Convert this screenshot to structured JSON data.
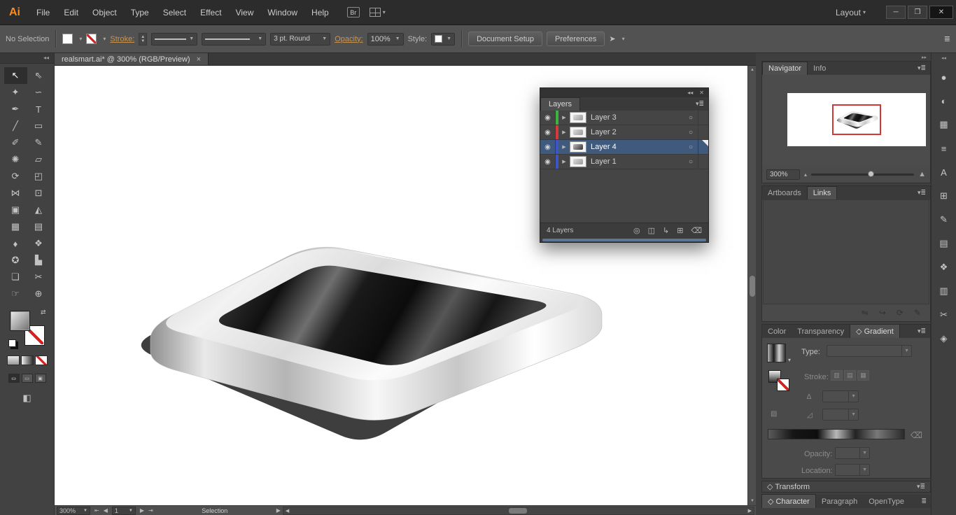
{
  "window_controls": {
    "minimize": "─",
    "restore": "❐",
    "close": "✕"
  },
  "menubar": {
    "logo": "Ai",
    "items": [
      "File",
      "Edit",
      "Object",
      "Type",
      "Select",
      "Effect",
      "View",
      "Window",
      "Help"
    ],
    "bridge_badge": "Br",
    "layout_label": "Layout",
    "caret": "▾"
  },
  "controlbar": {
    "selection_status": "No Selection",
    "stroke_label": "Stroke:",
    "brush_size_value": "3 pt. Round",
    "opacity_label": "Opacity:",
    "opacity_value": "100%",
    "style_label": "Style:",
    "document_setup": "Document Setup",
    "preferences": "Preferences",
    "select_similar_icon": "➤",
    "panel_menu_icon": "≣"
  },
  "document_tab": {
    "title": "realsmart.ai* @ 300% (RGB/Preview)",
    "close": "×"
  },
  "toolbar": {
    "collapse": "◂◂",
    "tools": [
      {
        "name": "selection-tool",
        "glyph": "↖"
      },
      {
        "name": "direct-selection-tool",
        "glyph": "⇖"
      },
      {
        "name": "magic-wand-tool",
        "glyph": "✦"
      },
      {
        "name": "lasso-tool",
        "glyph": "∽"
      },
      {
        "name": "pen-tool",
        "glyph": "✒"
      },
      {
        "name": "type-tool",
        "glyph": "T"
      },
      {
        "name": "line-segment-tool",
        "glyph": "╱"
      },
      {
        "name": "rectangle-tool",
        "glyph": "▭"
      },
      {
        "name": "paintbrush-tool",
        "glyph": "✐"
      },
      {
        "name": "pencil-tool",
        "glyph": "✎"
      },
      {
        "name": "blob-brush-tool",
        "glyph": "✺"
      },
      {
        "name": "eraser-tool",
        "glyph": "▱"
      },
      {
        "name": "rotate-tool",
        "glyph": "⟳"
      },
      {
        "name": "scale-tool",
        "glyph": "◰"
      },
      {
        "name": "width-tool",
        "glyph": "⋈"
      },
      {
        "name": "free-transform-tool",
        "glyph": "⊡"
      },
      {
        "name": "shape-builder-tool",
        "glyph": "▣"
      },
      {
        "name": "perspective-grid-tool",
        "glyph": "◭"
      },
      {
        "name": "mesh-tool",
        "glyph": "▦"
      },
      {
        "name": "gradient-tool",
        "glyph": "▤"
      },
      {
        "name": "eyedropper-tool",
        "glyph": "♦"
      },
      {
        "name": "blend-tool",
        "glyph": "❖"
      },
      {
        "name": "symbol-sprayer-tool",
        "glyph": "✪"
      },
      {
        "name": "column-graph-tool",
        "glyph": "▙"
      },
      {
        "name": "artboard-tool",
        "glyph": "❏"
      },
      {
        "name": "slice-tool",
        "glyph": "✂"
      },
      {
        "name": "hand-tool",
        "glyph": "☞"
      },
      {
        "name": "zoom-tool",
        "glyph": "⊕"
      }
    ]
  },
  "layers_panel": {
    "collapse": "◂◂",
    "close": "✕",
    "tab": "Layers",
    "menu_icon": "▾≣",
    "eye": "◉",
    "disclosure": "▶",
    "target": "○",
    "rows": [
      {
        "label": "Layer 3",
        "bar": "background:#3cb53c"
      },
      {
        "label": "Layer 2",
        "bar": "background:#d63b3b"
      },
      {
        "label": "Layer 4",
        "bar": "background:#3c55c8"
      },
      {
        "label": "Layer 1",
        "bar": "background:#3c55c8"
      }
    ],
    "status": "4 Layers",
    "bottom_icons": [
      {
        "name": "locate-object-icon",
        "glyph": "◎"
      },
      {
        "name": "make-clipping-mask-icon",
        "glyph": "◫"
      },
      {
        "name": "new-sublayer-icon",
        "glyph": "↳"
      },
      {
        "name": "new-layer-icon",
        "glyph": "⊞"
      },
      {
        "name": "delete-selection-icon",
        "glyph": "⌫"
      }
    ]
  },
  "navigator_panel": {
    "tab_navigator": "Navigator",
    "tab_info": "Info",
    "menu_icon": "▾≣",
    "zoom_value": "300%",
    "zoom_out": "▴",
    "zoom_in": "▲"
  },
  "links_panel": {
    "tab_artboards": "Artboards",
    "tab_links": "Links",
    "menu_icon": "▾≣",
    "icons": [
      {
        "name": "relink-icon",
        "glyph": "⇋"
      },
      {
        "name": "go-to-link-icon",
        "glyph": "↪"
      },
      {
        "name": "update-link-icon",
        "glyph": "⟳"
      },
      {
        "name": "edit-original-icon",
        "glyph": "✎"
      }
    ]
  },
  "gradient_panel": {
    "tab_color": "Color",
    "tab_transparency": "Transparency",
    "tab_gradient": "◇ Gradient",
    "menu_icon": "▾≣",
    "type_label": "Type:",
    "stroke_label": "Stroke:",
    "angle_icon": "∆",
    "aspect_icon": "◿",
    "annot_icon": "▧",
    "delete_icon": "⌫",
    "opacity_label": "Opacity:",
    "location_label": "Location:",
    "caret": "▾"
  },
  "transform_panel": {
    "title": "◇ Transform",
    "menu_icon": "▾≣"
  },
  "type_tabs": {
    "tabs": [
      "◇ Character",
      "Paragraph",
      "OpenType"
    ],
    "menu_icon": "≣"
  },
  "right_strip": {
    "expand": "◂◂",
    "icons": [
      {
        "name": "color-panel-icon",
        "glyph": "●"
      },
      {
        "name": "color-guide-panel-icon",
        "glyph": "◐"
      },
      {
        "name": "swatches-panel-icon",
        "glyph": "▦"
      },
      {
        "name": "brushes-panel-icon",
        "glyph": "≡"
      },
      {
        "name": "character-styles-panel-icon",
        "glyph": "A"
      },
      {
        "name": "symbols-panel-icon",
        "glyph": "⊞"
      },
      {
        "name": "appearance-panel-icon",
        "glyph": "✎"
      },
      {
        "name": "gradient-panel-icon",
        "glyph": "▤"
      },
      {
        "name": "graphic-styles-panel-icon",
        "glyph": "❖"
      },
      {
        "name": "stroke-panel-icon",
        "glyph": "▥"
      },
      {
        "name": "pathfinder-panel-icon",
        "glyph": "✂"
      },
      {
        "name": "transparency-panel-icon",
        "glyph": "◈"
      }
    ]
  },
  "statusbar": {
    "zoom_value": "300%",
    "first": "⇤",
    "prev": "◀",
    "artboard": "1",
    "next": "▶",
    "last": "⇥",
    "tool_label": "Selection",
    "field_arrow": "▶",
    "caret": "▾"
  },
  "scroll": {
    "up": "▲",
    "down": "▼",
    "left": "◀",
    "right": "▶"
  },
  "colors": {
    "selection_highlight": "#3f5a7d",
    "link_label": "#c9954f",
    "proxy_red": "#d43535",
    "logo_orange": "#ff8a1d"
  }
}
